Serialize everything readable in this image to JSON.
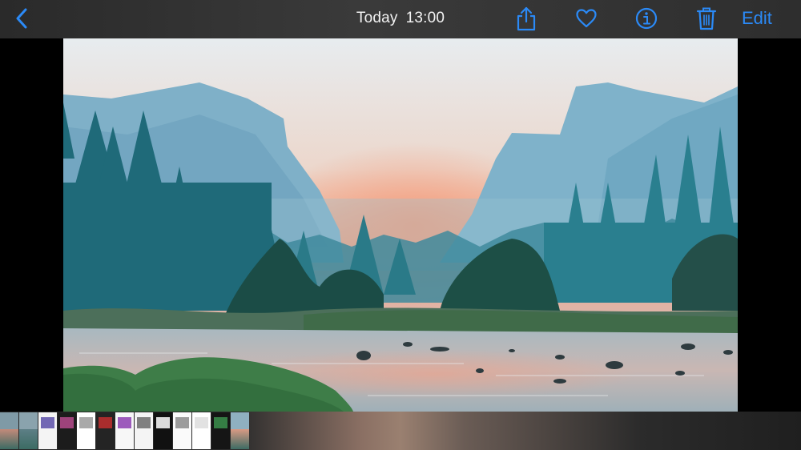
{
  "header": {
    "date": "Today",
    "time": "13:00",
    "edit_label": "Edit"
  },
  "icons": {
    "back": "chevron-left-icon",
    "share": "share-icon",
    "favorite": "heart-icon",
    "info": "info-icon",
    "delete": "trash-icon"
  },
  "colors": {
    "accent": "#2b8af7",
    "bar_background": "#333333",
    "photo_sky_top": "#d9e6ee",
    "photo_sky_glow": "#f1a483",
    "mountains": "#7fb3cc",
    "trees": "#1f6d7a",
    "water": "#b9c6cc"
  },
  "thumbnails": [
    {
      "kind": "landscape",
      "bg": "#7f9aa6",
      "fg": "#c38a7a"
    },
    {
      "kind": "landscape",
      "bg": "#8aa3ad",
      "fg": "#5d7f86"
    },
    {
      "kind": "screenshot",
      "bg": "#f4f4f4",
      "fg": "#5a4fa8"
    },
    {
      "kind": "screenshot",
      "bg": "#1c1c1c",
      "fg": "#b54a8c"
    },
    {
      "kind": "screenshot",
      "bg": "#ffffff",
      "fg": "#9a9a9a"
    },
    {
      "kind": "screenshot",
      "bg": "#242424",
      "fg": "#c22f2f"
    },
    {
      "kind": "screenshot",
      "bg": "#f7f7f7",
      "fg": "#8d3fb2"
    },
    {
      "kind": "screenshot",
      "bg": "#f4f4f4",
      "fg": "#6b6b6b"
    },
    {
      "kind": "screenshot",
      "bg": "#111111",
      "fg": "#ffffff"
    },
    {
      "kind": "screenshot",
      "bg": "#fafafa",
      "fg": "#8a8a8a"
    },
    {
      "kind": "screenshot",
      "bg": "#ffffff",
      "fg": "#dddddd"
    },
    {
      "kind": "screenshot",
      "bg": "#151515",
      "fg": "#3b8f4c"
    },
    {
      "kind": "landscape",
      "bg": "#8fb0c0",
      "fg": "#d99a84"
    }
  ]
}
